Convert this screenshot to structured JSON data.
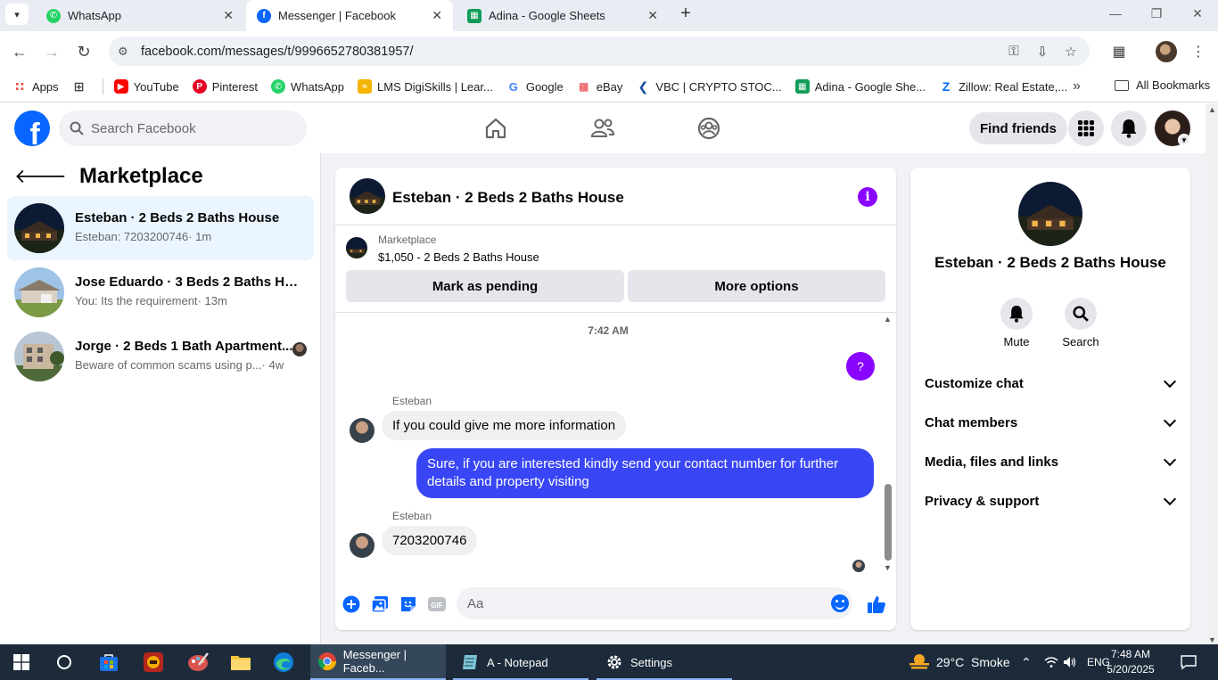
{
  "browser": {
    "tabs": [
      {
        "title": "WhatsApp",
        "favicon": "whatsapp-icon",
        "active": false
      },
      {
        "title": "Messenger | Facebook",
        "favicon": "facebook-icon",
        "active": true
      },
      {
        "title": "Adina - Google Sheets",
        "favicon": "sheets-icon",
        "active": false
      }
    ],
    "url": "facebook.com/messages/t/9996652780381957/",
    "bookmarks": [
      {
        "label": "Apps",
        "icon": "apps-grid-icon"
      },
      {
        "label": "YouTube",
        "icon": "youtube-icon"
      },
      {
        "label": "Pinterest",
        "icon": "pinterest-icon"
      },
      {
        "label": "WhatsApp",
        "icon": "whatsapp-icon"
      },
      {
        "label": "LMS DigiSkills | Lear...",
        "icon": "lms-icon"
      },
      {
        "label": "Google",
        "icon": "google-icon"
      },
      {
        "label": "eBay",
        "icon": "ebay-icon"
      },
      {
        "label": "VBC | CRYPTO STOC...",
        "icon": "vbc-icon"
      },
      {
        "label": "Adina - Google She...",
        "icon": "sheets-icon"
      },
      {
        "label": "Zillow: Real Estate,...",
        "icon": "zillow-icon"
      }
    ],
    "all_bookmarks": "All Bookmarks"
  },
  "fb_header": {
    "logo": "f",
    "search_placeholder": "Search Facebook",
    "find_friends": "Find friends"
  },
  "left_panel": {
    "title": "Marketplace",
    "conversations": [
      {
        "name": "Esteban · 2 Beds 2 Baths House",
        "snippet": "Esteban: 7203200746",
        "time": " · 1m",
        "selected": true
      },
      {
        "name": "Jose Eduardo · 3 Beds 2 Baths Hou...",
        "snippet": "You: Its the requirement",
        "time": " · 13m",
        "selected": false
      },
      {
        "name": "Jorge · 2 Beds 1 Bath Apartment...",
        "snippet": "Beware of common scams using p...",
        "time": " · 4w",
        "selected": false
      }
    ]
  },
  "chat": {
    "title": "Esteban · 2 Beds 2 Baths House",
    "listing_source": "Marketplace",
    "listing_title": "$1,050 - 2 Beds 2 Baths House",
    "mark_pending": "Mark as pending",
    "more_options": "More options",
    "timestamp": "7:42 AM",
    "sent_question": "?",
    "messages": [
      {
        "sender": "Esteban",
        "text": "If you could give me more information"
      },
      {
        "sender": "You",
        "text": "Sure, if you are interested kindly send your contact number for further details and property visiting"
      },
      {
        "sender": "Esteban",
        "text": "7203200746"
      }
    ],
    "composer_placeholder": "Aa",
    "gif_label": "GIF"
  },
  "info_panel": {
    "name": "Esteban · 2 Beds 2 Baths House",
    "mute": "Mute",
    "search": "Search",
    "sections": [
      "Customize chat",
      "Chat members",
      "Media, files and links",
      "Privacy & support"
    ]
  },
  "taskbar": {
    "apps": [
      {
        "label": "Messenger | Faceb...",
        "icon": "chrome-icon"
      },
      {
        "label": "A - Notepad",
        "icon": "notepad-icon"
      },
      {
        "label": "Settings",
        "icon": "settings-gear-icon"
      }
    ],
    "weather": "29°C  Smoke",
    "language": "ENG",
    "time": "7:48 AM",
    "date": "5/20/2025"
  },
  "colors": {
    "fb_blue": "#0866ff",
    "messenger_purple": "#8a05ff",
    "outgoing_bubble": "#3946f5",
    "selected_conv": "#ebf5ff"
  }
}
